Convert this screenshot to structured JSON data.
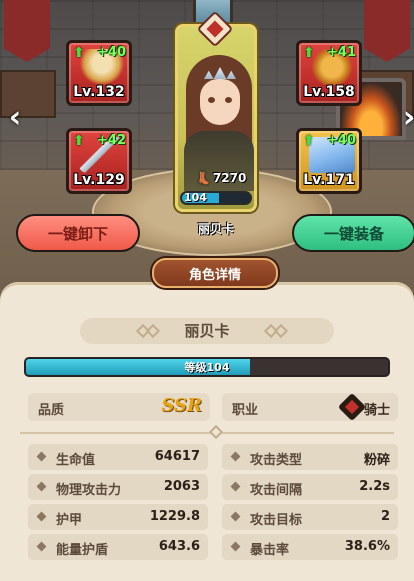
{
  "slots": {
    "armor": {
      "plus": "+40",
      "level": "Lv.132"
    },
    "helm": {
      "plus": "+41",
      "level": "Lv.158"
    },
    "sword": {
      "plus": "+42",
      "level": "Lv.129"
    },
    "crystal": {
      "plus": "+40",
      "level": "Lv.171"
    }
  },
  "hero": {
    "name": "丽贝卡",
    "power": "7270",
    "level_num": "104",
    "exp_fraction": 0.55
  },
  "buttons": {
    "unequip_all": "一键卸下",
    "equip_all": "一键装备"
  },
  "details_tab": "角色详情",
  "panel": {
    "name": "丽贝卡",
    "level_label": "等级104",
    "level_fraction": 0.62,
    "quality_label": "品质",
    "quality_value": "SSR",
    "class_label": "职业",
    "class_value": "骑士"
  },
  "stats": [
    {
      "label": "生命值",
      "value": "64617"
    },
    {
      "label": "攻击类型",
      "value": "粉碎"
    },
    {
      "label": "物理攻击力",
      "value": "2063"
    },
    {
      "label": "攻击间隔",
      "value": "2.2s"
    },
    {
      "label": "护甲",
      "value": "1229.8"
    },
    {
      "label": "攻击目标",
      "value": "2"
    },
    {
      "label": "能量护盾",
      "value": "643.6"
    },
    {
      "label": "暴击率",
      "value": "38.6%"
    }
  ],
  "colors": {
    "slot_red": "#d2332e",
    "slot_gold": "#eab33a",
    "unequip": "#f26b5c",
    "equip": "#3fd394",
    "level_bar": "#35b9d6",
    "ssr": "#e5a315"
  },
  "icons": {
    "nav_left": "chevron-left-icon",
    "nav_right": "chevron-right-icon",
    "upgrade": "green-up-arrow-icon",
    "power": "boot-icon",
    "class": "knight-shield-icon"
  }
}
